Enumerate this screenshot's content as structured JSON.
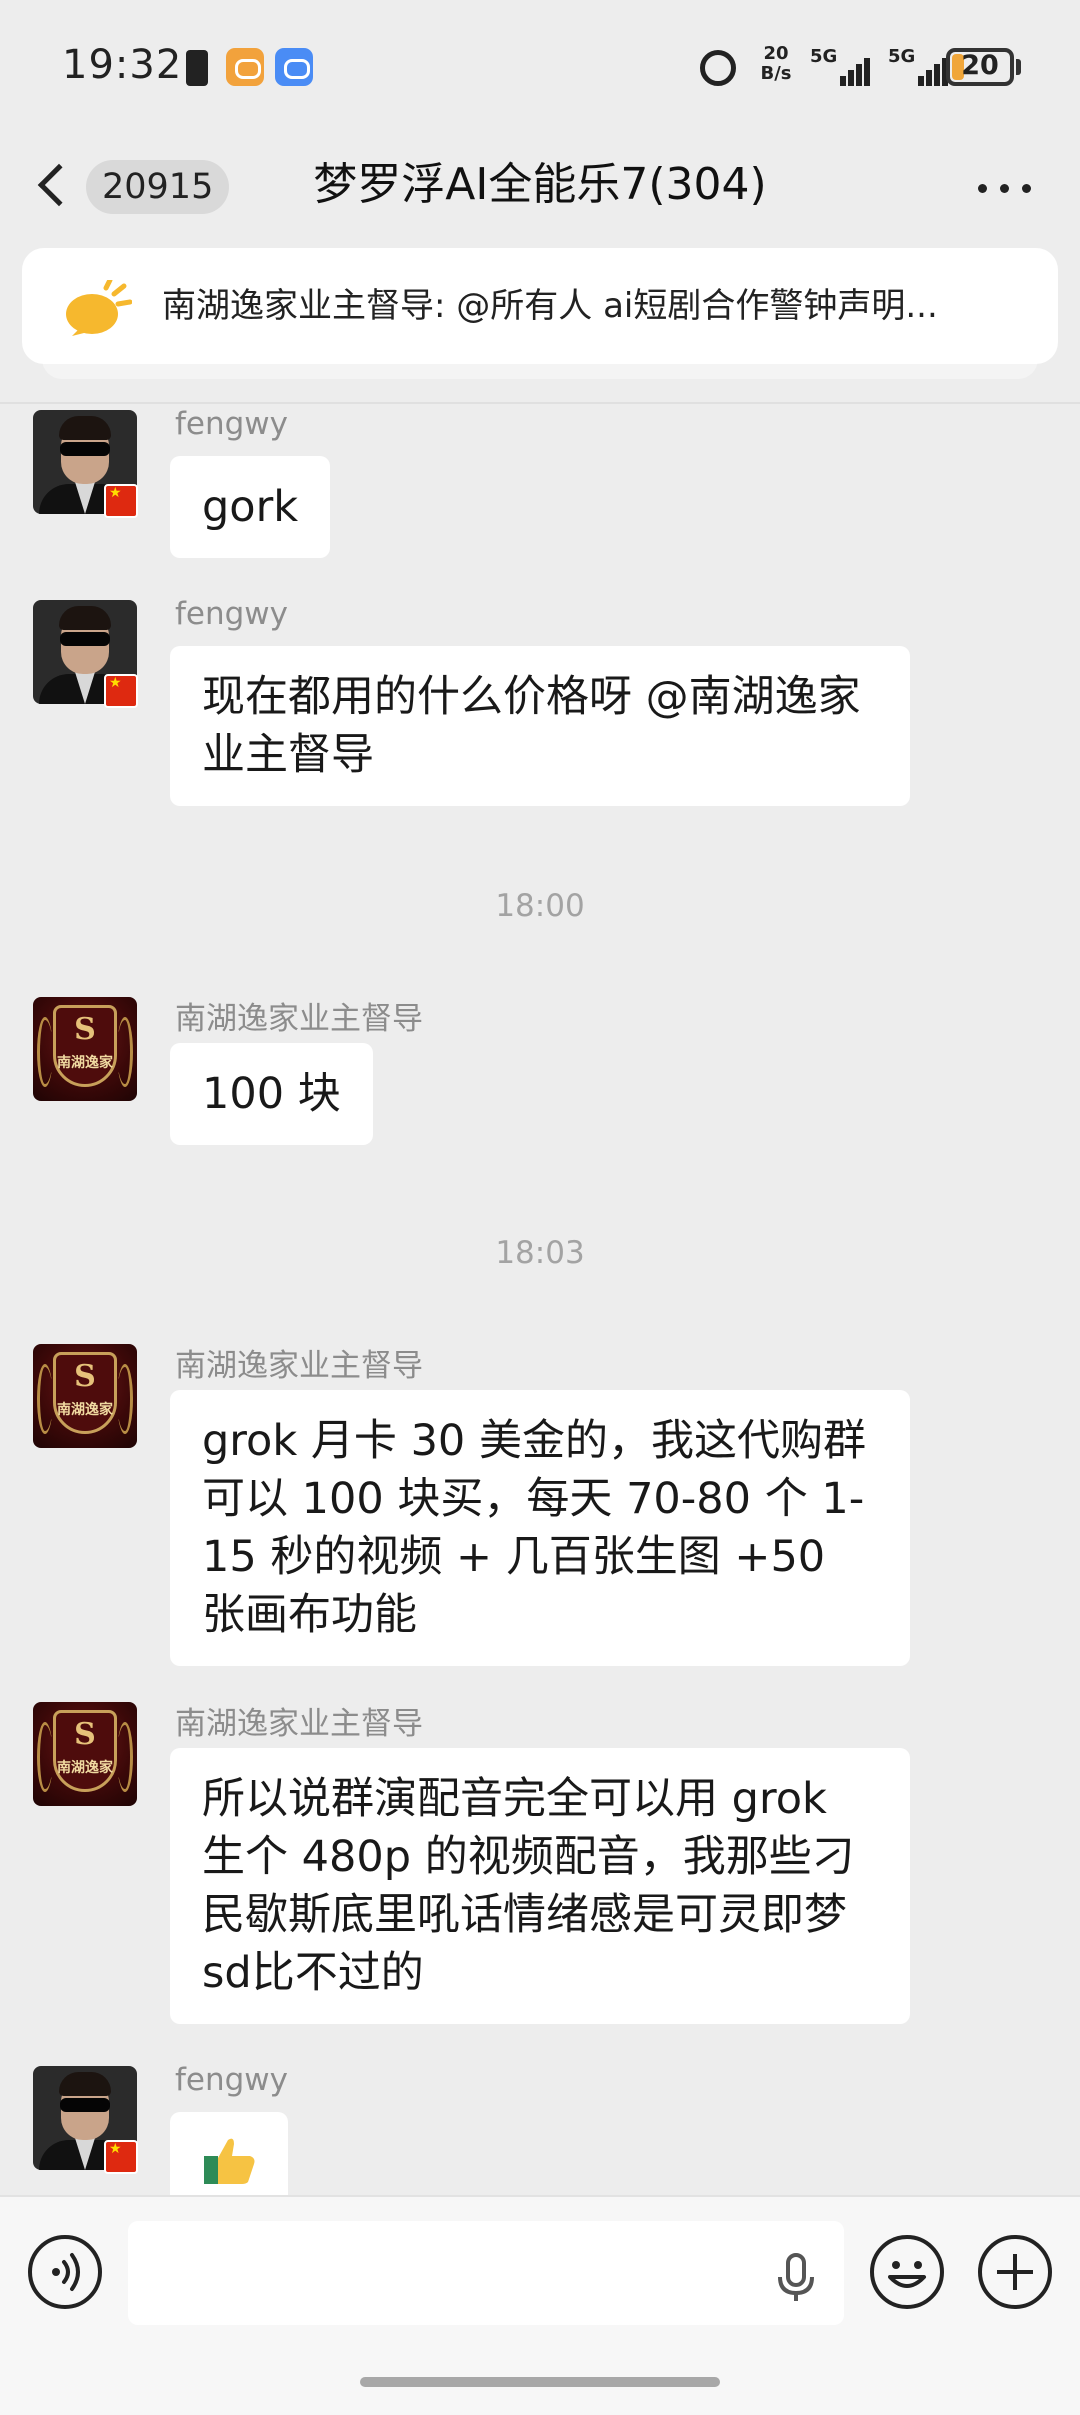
{
  "status_bar": {
    "time": "19:32",
    "net_speed_value": "20",
    "net_speed_unit": "B/s",
    "signal_1": "5G",
    "signal_2": "5G",
    "battery": "20"
  },
  "header": {
    "unread_count": "20915",
    "title": "梦罗浮AI全能乐7(304)"
  },
  "pinned": {
    "text": "南湖逸家业主督导: @所有人 ai短剧合作警钟声明..."
  },
  "messages": [
    {
      "sender": "fengwy",
      "text": "gork"
    },
    {
      "sender": "fengwy",
      "text": "现在都用的什么价格呀 @南湖逸家业主督导"
    },
    {
      "sender": "南湖逸家业主督导",
      "text": "100 块"
    },
    {
      "sender": "南湖逸家业主督导",
      "text": "grok 月卡 30 美金的，我这代购群可以 100 块买，每天 70-80 个 1-15 秒的视频 + 几百张生图 +50 张画布功能"
    },
    {
      "sender": "南湖逸家业主督导",
      "text": "所以说群演配音完全可以用 grok 生个 480p 的视频配音，我那些刁民歇斯底里吼话情绪感是可灵即梦 sd比不过的"
    },
    {
      "sender": "fengwy",
      "text": "",
      "emoji": "thumbs-up"
    }
  ],
  "time_dividers": [
    "18:00",
    "18:03"
  ],
  "brand_avatar_text": {
    "logo": "S",
    "name": "南湖逸家"
  },
  "input": {
    "placeholder": "",
    "value": ""
  },
  "colors": {
    "background": "#ededed",
    "bubble": "#ffffff",
    "sender_name": "#8c8c8c",
    "badge": "#d9d9d9",
    "battery_fill": "#f0a63a"
  }
}
